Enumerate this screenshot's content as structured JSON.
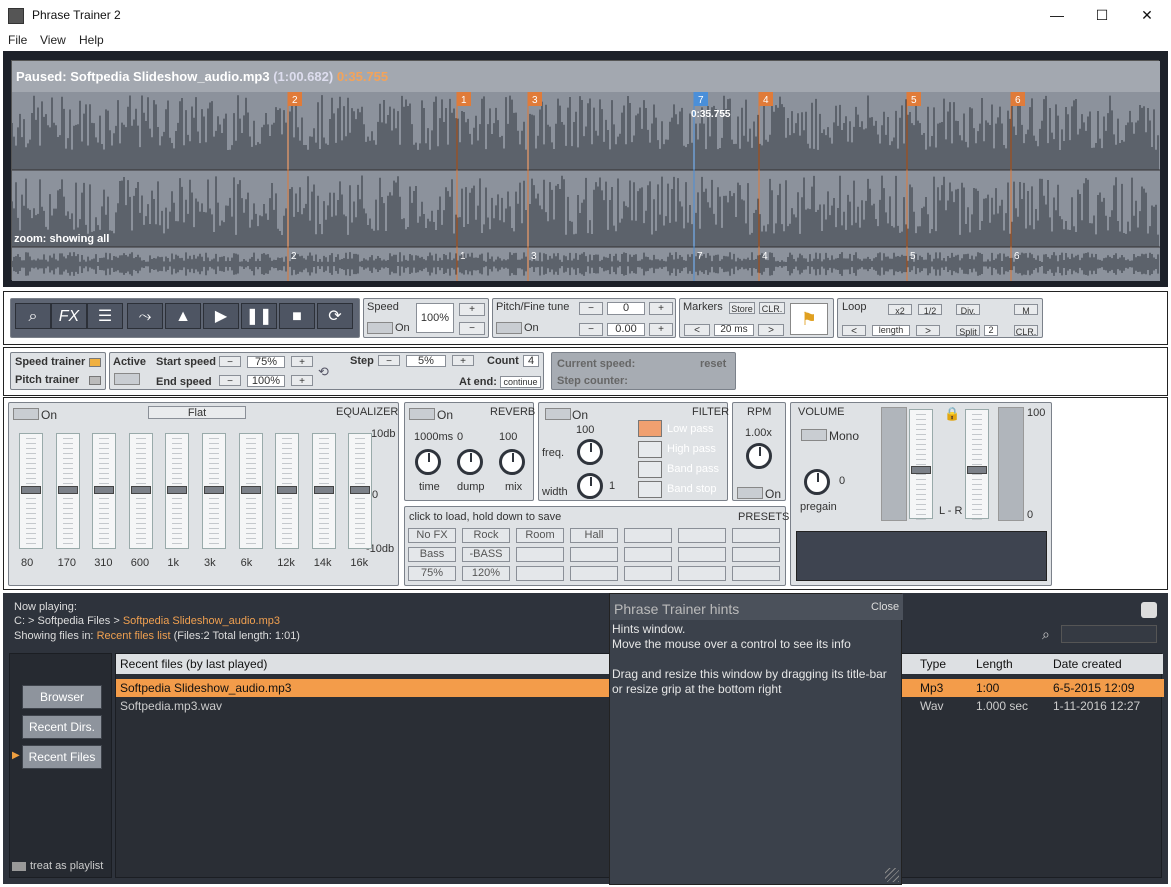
{
  "window": {
    "title": "Phrase Trainer 2",
    "minimize": "—",
    "maximize": "☐",
    "close": "✕"
  },
  "menu": [
    "File",
    "View",
    "Help"
  ],
  "waveform": {
    "status": "Paused:",
    "file": "Softpedia Slideshow_audio.mp3",
    "duration": "(1:00.682)",
    "position": "0:35.755",
    "zoom": "zoom: showing all",
    "cursor_label": "0:35.755",
    "markers": [
      "2",
      "1",
      "3",
      "7",
      "4",
      "5",
      "6"
    ],
    "marker_colors": {
      "orange": "#e07b39",
      "blue": "#4a8fd9"
    }
  },
  "speed": {
    "label": "Speed",
    "value": "100%",
    "on": "On",
    "plus": "+",
    "minus": "−"
  },
  "pitch": {
    "label": "Pitch/Fine tune",
    "value": "0",
    "fine": "0.00",
    "on": "On"
  },
  "markers": {
    "label": "Markers",
    "store": "Store",
    "clr": "CLR.",
    "ms": "20 ms",
    "prev": "<",
    "next": ">"
  },
  "loop": {
    "label": "Loop",
    "x2": "x2",
    "half": "1/2",
    "div": "Div.",
    "m": "M",
    "length": "length",
    "split": "Split",
    "split_val": "2",
    "clr": "CLR."
  },
  "trainer": {
    "speed_trainer": "Speed trainer",
    "pitch_trainer": "Pitch trainer",
    "active": "Active",
    "start_speed": "Start speed",
    "start_val": "75%",
    "end_speed": "End speed",
    "end_val": "100%",
    "step": "Step",
    "step_val": "5%",
    "count": "Count",
    "count_val": "4",
    "at_end": "At end:",
    "at_end_val": "continue",
    "current_speed": "Current speed:",
    "reset": "reset",
    "step_counter": "Step counter:"
  },
  "equalizer": {
    "on": "On",
    "preset": "Flat",
    "title": "EQUALIZER",
    "db_top": "10db",
    "db_mid": "0",
    "db_bot": "-10db",
    "bands": [
      "80",
      "170",
      "310",
      "600",
      "1k",
      "3k",
      "6k",
      "12k",
      "14k",
      "16k"
    ]
  },
  "reverb": {
    "on": "On",
    "title": "REVERB",
    "v1": "1000ms",
    "v2": "0",
    "v3": "100",
    "k1": "time",
    "k2": "dump",
    "k3": "mix"
  },
  "filter": {
    "on": "On",
    "title": "FILTER",
    "freq": "freq.",
    "freq_val": "100",
    "width": "width",
    "width_val": "1",
    "types": [
      "Low pass",
      "High pass",
      "Band pass",
      "Band stop"
    ]
  },
  "rpm": {
    "title": "RPM",
    "value": "1.00x",
    "on": "On"
  },
  "volume": {
    "title": "VOLUME",
    "mono": "Mono",
    "pregain": "pregain",
    "pregain_val": "0",
    "lr": "L - R",
    "top": "100",
    "bottom": "0"
  },
  "presets": {
    "hint": "click to load, hold down to save",
    "title": "PRESETS",
    "row1": [
      "No FX",
      "Rock",
      "Room",
      "Hall",
      "",
      "",
      ""
    ],
    "row2": [
      "Bass",
      "-BASS",
      "",
      "",
      "",
      "",
      ""
    ],
    "row3": [
      "75%",
      "120%",
      "",
      "",
      "",
      "",
      ""
    ]
  },
  "browser": {
    "now_playing": "Now playing:",
    "path_prefix": "C: > Softpedia Files >",
    "path_file": "Softpedia Slideshow_audio.mp3",
    "showing_in": "Showing files in:",
    "list_name": "Recent files list",
    "list_info": "(Files:2  Total length: 1:01)",
    "buttons": [
      "Browser",
      "Recent Dirs.",
      "Recent Files"
    ],
    "treat_playlist": "treat as playlist",
    "columns": [
      "Recent files (by last played)",
      "Type",
      "Length",
      "Date created"
    ],
    "rows": [
      {
        "name": "Softpedia Slideshow_audio.mp3",
        "type": "Mp3",
        "length": "1:00",
        "date": "6-5-2015  12:09"
      },
      {
        "name": "Softpedia.mp3.wav",
        "type": "Wav",
        "length": "1.000 sec",
        "date": "1-11-2016  12:27"
      }
    ]
  },
  "hints": {
    "title": "Phrase Trainer hints",
    "close": "Close",
    "line1": "Hints window.",
    "line2": "Move the mouse over a control to see its info",
    "line3": "Drag and resize this window by dragging its title-bar or resize grip at the bottom right"
  }
}
